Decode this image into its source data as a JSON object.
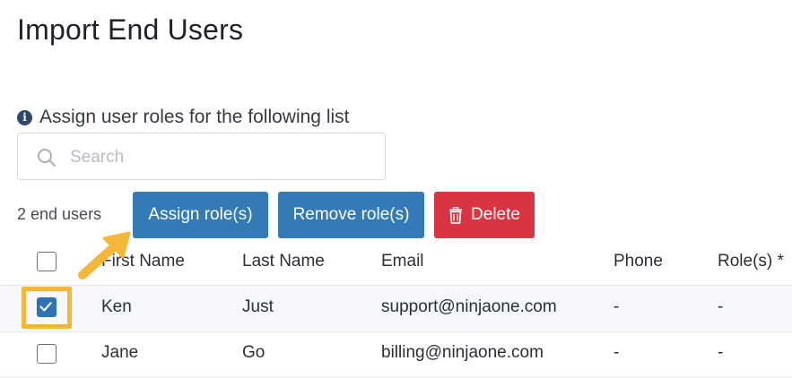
{
  "page": {
    "title": "Import End Users"
  },
  "instructions": {
    "text": "Assign user roles for the following list",
    "icon": "info-icon"
  },
  "search": {
    "placeholder": "Search",
    "value": ""
  },
  "toolbar": {
    "count_text": "2 end users",
    "assign_label": "Assign role(s)",
    "remove_label": "Remove role(s)",
    "delete_label": "Delete"
  },
  "table": {
    "columns": [
      "First Name",
      "Last Name",
      "Email",
      "Phone",
      "Role(s) *"
    ],
    "rows": [
      {
        "first": "Ken",
        "last": "Just",
        "email": "support@ninjaone.com",
        "phone": "-",
        "roles": "-",
        "selected": true
      },
      {
        "first": "Jane",
        "last": "Go",
        "email": "billing@ninjaone.com",
        "phone": "-",
        "roles": "-",
        "selected": false
      }
    ]
  },
  "colors": {
    "primary": "#337ab7",
    "danger": "#d83442",
    "highlight": "#f4b73a"
  }
}
